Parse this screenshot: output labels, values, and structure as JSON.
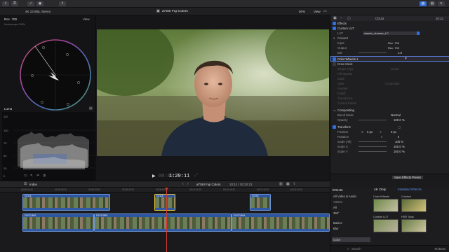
{
  "toolbar": {
    "buttons": [
      "download-icon",
      "key-icon",
      "check-icon",
      "share-icon"
    ],
    "right_icons": [
      "grid-icon",
      "layers-icon",
      "sliders-icon"
    ]
  },
  "viewer_header": {
    "format": "4K 23.98p, Stereo",
    "clip_title": "a7SIII Fuji Colors",
    "zoom": "50%",
    "view": "View"
  },
  "scopes": {
    "vectorscope_title": "Rec. 709",
    "vectorscope_view": "View",
    "vectorscope_sub": "Vectorscope 100%",
    "luma_title": "Luma",
    "waveform_ticks": [
      "100",
      "75",
      "50",
      "25",
      "0",
      "-10"
    ],
    "waveform_top": "110"
  },
  "viewer": {
    "timecode_dim": "00:00:0",
    "timecode": "1:29:11",
    "play_icon": "play-icon"
  },
  "inspector": {
    "tab_title": "C0115",
    "tab_time": "10:12",
    "effects_label": "Effects",
    "custom_lut_label": "Custom LUT",
    "lut_label": "LUT",
    "lut_value": "classic_chrome_LC",
    "convert_label": "Convert",
    "input_label": "Input",
    "input_value": "Rec. 709",
    "output_label": "Output",
    "output_value": "Rec. 709",
    "mix_label": "Mix",
    "mix_value": "1.0",
    "color_wheels_label": "Color Wheels 1",
    "draw_mask_label": "Draw Mask",
    "shape_type_label": "Shape Type",
    "shape_type_value": "Linear",
    "fill_opacity_label": "Fill Opacity",
    "mask_label": "Mask",
    "view_label": "View",
    "view_value": "Composite",
    "feather_label": "Feather",
    "falloff_label": "Falloff",
    "transforms_label": "Transforms",
    "control_points_label": "Control Points",
    "compositing_label": "Compositing",
    "blend_mode_label": "Blend Mode",
    "blend_mode_value": "Normal",
    "opacity_label": "Opacity",
    "opacity_value": "100.0 %",
    "transform_label": "Transform",
    "position_label": "Position",
    "position_x_label": "X",
    "position_x": "0 px",
    "position_y_label": "Y",
    "position_y": "0 px",
    "rotation_label": "Rotation",
    "rotation_value": "0",
    "scale_all_label": "Scale (All)",
    "scale_all_value": "100 %",
    "scale_x_label": "Scale X",
    "scale_x_value": "100.0 %",
    "scale_y_label": "Scale Y",
    "scale_y_value": "100.0 %",
    "save_preset": "Save Effects Preset"
  },
  "timeline_bar": {
    "index": "Index",
    "clip_name": "a7SIII Fuji Colors",
    "duration": "10:12 / 03:20:22"
  },
  "timeline": {
    "ruler_marks": [
      "00:00:10:00",
      "00:00:20:00",
      "00:00:30:00",
      "00:00:40:00",
      "00:00:50:00",
      "00:01:00:00",
      "00:01:10:00",
      "00:01:20:00",
      "00:01:30:00"
    ],
    "clip_top_a": "C0114",
    "clip_top_b": "C0116",
    "clip_top_sel": "C0115",
    "clip_main_a": "DSCF4862",
    "clip_main_b": "DSCF4863",
    "clip_main_c": "DSCF4864"
  },
  "effects_browser": {
    "title": "Effects",
    "filter_4k": "4K Only",
    "installed": "Installed Effects",
    "categories": [
      "All Video & Audio",
      "VIDEO",
      "All",
      "360°",
      "Basics",
      "Blur",
      "Color"
    ],
    "thumbs": [
      "Color Wheels",
      "Colorize",
      "Custom LUT",
      "HSR Tools"
    ],
    "search_placeholder": "Search",
    "count": "72 items"
  },
  "colors": {
    "accent": "#2f6fe0",
    "clip_blue": "#3b6dbd",
    "selection_yellow": "#e8c23a",
    "playhead": "#d23a2e"
  }
}
